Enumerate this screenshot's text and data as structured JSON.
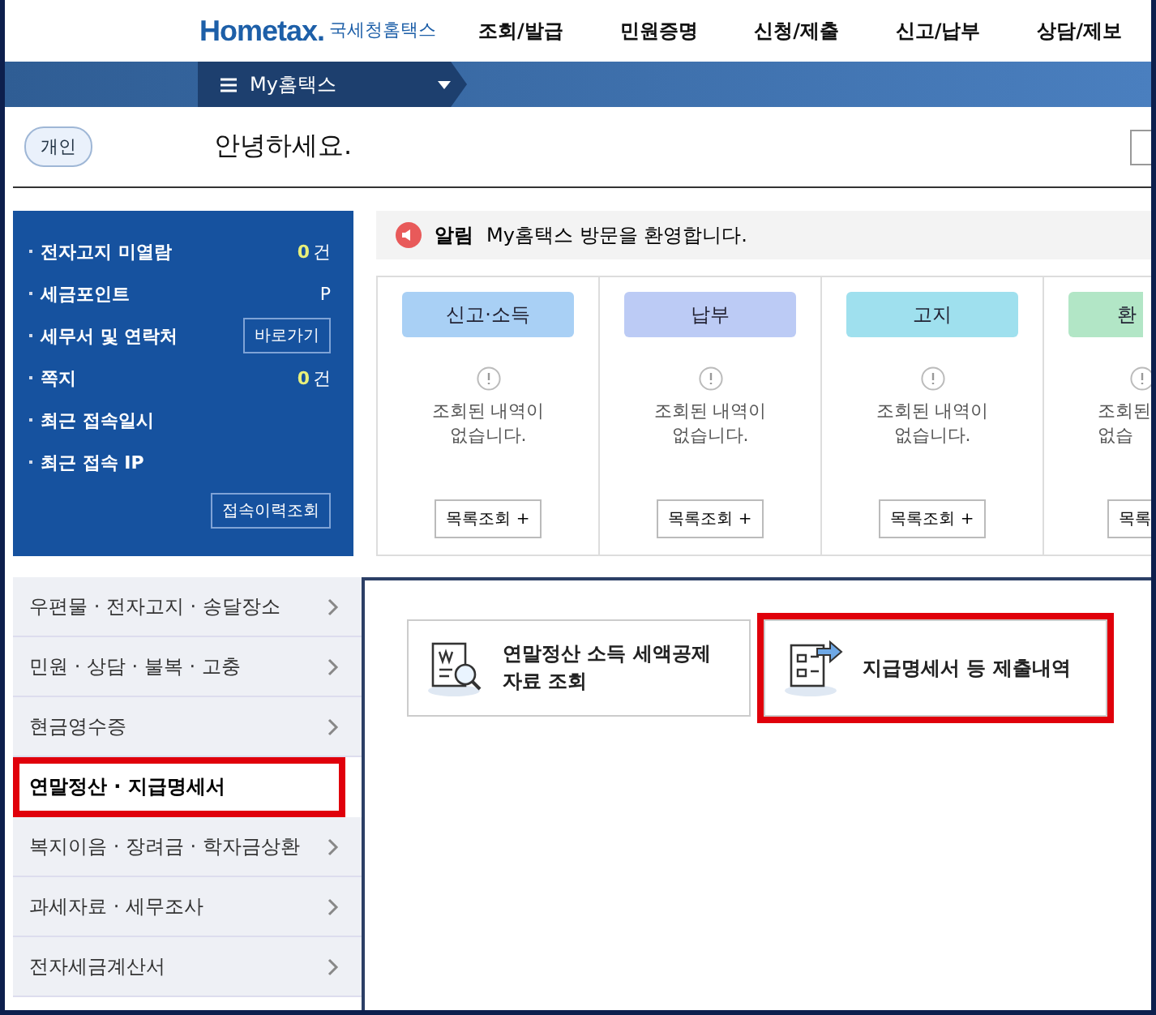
{
  "logo": {
    "brand": "Hometax.",
    "name": "국세청홈택스"
  },
  "nav": [
    "조회/발급",
    "민원증명",
    "신청/제출",
    "신고/납부",
    "상담/제보"
  ],
  "menu_bar": {
    "label": "My홈택스"
  },
  "greeting": {
    "badge": "개인",
    "text": "안녕하세요."
  },
  "summary": {
    "rows": [
      {
        "label": "전자고지 미열람",
        "value": "0",
        "unit": "건"
      },
      {
        "label": "세금포인트",
        "value": "P"
      },
      {
        "label": "세무서 및 연락처",
        "action": "바로가기"
      },
      {
        "label": "쪽지",
        "value": "0",
        "unit": "건"
      },
      {
        "label": "최근 접속일시"
      },
      {
        "label": "최근 접속 IP"
      }
    ],
    "history_button": "접속이력조회"
  },
  "notice": {
    "label": "알림",
    "text": "My홈택스 방문을 환영합니다."
  },
  "cards": [
    {
      "title": "신고·소득",
      "color": "#a9d0f5",
      "message": [
        "조회된 내역이",
        "없습니다."
      ],
      "button": "목록조회 +"
    },
    {
      "title": "납부",
      "color": "#bccbf5",
      "message": [
        "조회된 내역이",
        "없습니다."
      ],
      "button": "목록조회 +"
    },
    {
      "title": "고지",
      "color": "#9fe0ee",
      "message": [
        "조회된 내역이",
        "없습니다."
      ],
      "button": "목록조회 +"
    },
    {
      "title": "환",
      "color": "#b2e6c6",
      "message": [
        "조회된",
        "없습"
      ],
      "button": "목록"
    }
  ],
  "side_menu": [
    {
      "label": "우편물 · 전자고지 · 송달장소",
      "selected": false,
      "highlighted": false
    },
    {
      "label": "민원 · 상담 · 불복 · 고충",
      "selected": false,
      "highlighted": false
    },
    {
      "label": "현금영수증",
      "selected": false,
      "highlighted": false
    },
    {
      "label": "연말정산 · 지급명세서",
      "selected": true,
      "highlighted": true
    },
    {
      "label": "복지이음 · 장려금 · 학자금상환",
      "selected": false,
      "highlighted": false
    },
    {
      "label": "과세자료 · 세무조사",
      "selected": false,
      "highlighted": false
    },
    {
      "label": "전자세금계산서",
      "selected": false,
      "highlighted": false
    }
  ],
  "tiles": [
    {
      "kind": "search",
      "text": "연말정산 소득 세액공제 자료 조회",
      "highlighted": false
    },
    {
      "kind": "submit",
      "text": "지급명세서 등 제출내역",
      "highlighted": true
    }
  ]
}
